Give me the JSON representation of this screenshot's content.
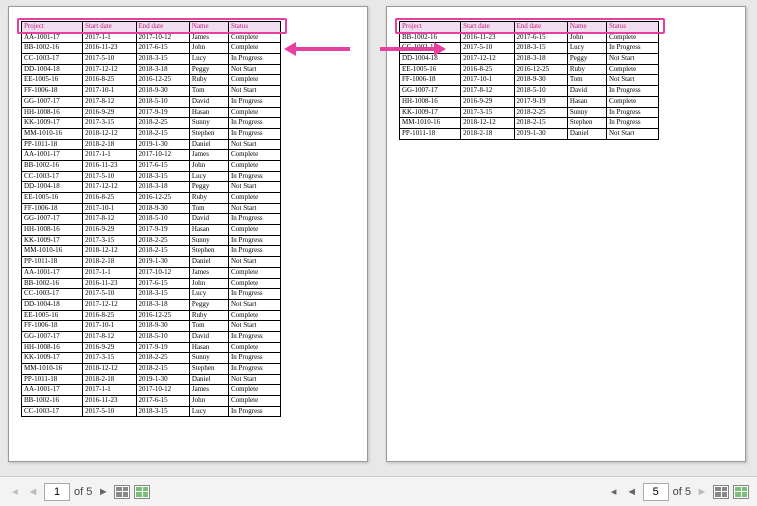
{
  "columns": [
    "Project",
    "Start date",
    "End date",
    "Name",
    "Status"
  ],
  "page1": {
    "rows": [
      [
        "AA-1001-17",
        "2017-1-1",
        "2017-10-12",
        "James",
        "Complete"
      ],
      [
        "BB-1002-16",
        "2016-11-23",
        "2017-6-15",
        "John",
        "Complete"
      ],
      [
        "CC-1003-17",
        "2017-5-10",
        "2018-3-15",
        "Lucy",
        "In Progress"
      ],
      [
        "DD-1004-18",
        "2017-12-12",
        "2018-3-18",
        "Peggy",
        "Not Start"
      ],
      [
        "EE-1005-16",
        "2016-8-25",
        "2016-12-25",
        "Ruby",
        "Complete"
      ],
      [
        "FF-1006-18",
        "2017-10-1",
        "2018-9-30",
        "Tom",
        "Not Start"
      ],
      [
        "GG-1007-17",
        "2017-8-12",
        "2018-5-10",
        "David",
        "In Progress"
      ],
      [
        "HH-1008-16",
        "2016-9-29",
        "2017-9-19",
        "Hasan",
        "Complete"
      ],
      [
        "KK-1009-17",
        "2017-3-15",
        "2018-2-25",
        "Sunny",
        "In Progress"
      ],
      [
        "MM-1010-16",
        "2018-12-12",
        "2018-2-15",
        "Stephen",
        "In Progress"
      ],
      [
        "PP-1011-18",
        "2018-2-18",
        "2019-1-30",
        "Daniel",
        "Not Start"
      ],
      [
        "AA-1001-17",
        "2017-1-1",
        "2017-10-12",
        "James",
        "Complete"
      ],
      [
        "BB-1002-16",
        "2016-11-23",
        "2017-6-15",
        "John",
        "Complete"
      ],
      [
        "CC-1003-17",
        "2017-5-10",
        "2018-3-15",
        "Lucy",
        "In Progress"
      ],
      [
        "DD-1004-18",
        "2017-12-12",
        "2018-3-18",
        "Peggy",
        "Not Start"
      ],
      [
        "EE-1005-16",
        "2016-8-25",
        "2016-12-25",
        "Ruby",
        "Complete"
      ],
      [
        "FF-1006-18",
        "2017-10-1",
        "2018-9-30",
        "Tom",
        "Not Start"
      ],
      [
        "GG-1007-17",
        "2017-8-12",
        "2018-5-10",
        "David",
        "In Progress"
      ],
      [
        "HH-1008-16",
        "2016-9-29",
        "2017-9-19",
        "Hasan",
        "Complete"
      ],
      [
        "KK-1009-17",
        "2017-3-15",
        "2018-2-25",
        "Sunny",
        "In Progress"
      ],
      [
        "MM-1010-16",
        "2018-12-12",
        "2018-2-15",
        "Stephen",
        "In Progress"
      ],
      [
        "PP-1011-18",
        "2018-2-18",
        "2019-1-30",
        "Daniel",
        "Not Start"
      ],
      [
        "AA-1001-17",
        "2017-1-1",
        "2017-10-12",
        "James",
        "Complete"
      ],
      [
        "BB-1002-16",
        "2016-11-23",
        "2017-6-15",
        "John",
        "Complete"
      ],
      [
        "CC-1003-17",
        "2017-5-10",
        "2018-3-15",
        "Lucy",
        "In Progress"
      ],
      [
        "DD-1004-18",
        "2017-12-12",
        "2018-3-18",
        "Peggy",
        "Not Start"
      ],
      [
        "EE-1005-16",
        "2016-8-25",
        "2016-12-25",
        "Ruby",
        "Complete"
      ],
      [
        "FF-1006-18",
        "2017-10-1",
        "2018-9-30",
        "Tom",
        "Not Start"
      ],
      [
        "GG-1007-17",
        "2017-8-12",
        "2018-5-10",
        "David",
        "In Progress"
      ],
      [
        "HH-1008-16",
        "2016-9-29",
        "2017-9-19",
        "Hasan",
        "Complete"
      ],
      [
        "KK-1009-17",
        "2017-3-15",
        "2018-2-25",
        "Sunny",
        "In Progress"
      ],
      [
        "MM-1010-16",
        "2018-12-12",
        "2018-2-15",
        "Stephen",
        "In Progress"
      ],
      [
        "PP-1011-18",
        "2018-2-18",
        "2019-1-30",
        "Daniel",
        "Not Start"
      ],
      [
        "AA-1001-17",
        "2017-1-1",
        "2017-10-12",
        "James",
        "Complete"
      ],
      [
        "BB-1002-16",
        "2016-11-23",
        "2017-6-15",
        "John",
        "Complete"
      ],
      [
        "CC-1003-17",
        "2017-5-10",
        "2018-3-15",
        "Lucy",
        "In Progress"
      ]
    ],
    "current": "1",
    "total": "of 5"
  },
  "page5": {
    "rows": [
      [
        "BB-1002-16",
        "2016-11-23",
        "2017-6-15",
        "John",
        "Complete"
      ],
      [
        "CC-1003-17",
        "2017-5-10",
        "2018-3-15",
        "Lucy",
        "In Progress"
      ],
      [
        "DD-1004-18",
        "2017-12-12",
        "2018-3-18",
        "Peggy",
        "Not Start"
      ],
      [
        "EE-1005-16",
        "2016-8-25",
        "2016-12-25",
        "Ruby",
        "Complete"
      ],
      [
        "FF-1006-18",
        "2017-10-1",
        "2018-9-30",
        "Tom",
        "Not Start"
      ],
      [
        "GG-1007-17",
        "2017-8-12",
        "2018-5-10",
        "David",
        "In Progress"
      ],
      [
        "HH-1008-16",
        "2016-9-29",
        "2017-9-19",
        "Hasan",
        "Complete"
      ],
      [
        "KK-1009-17",
        "2017-3-15",
        "2018-2-25",
        "Sunny",
        "In Progress"
      ],
      [
        "MM-1010-16",
        "2018-12-12",
        "2018-2-15",
        "Stephen",
        "In Progress"
      ],
      [
        "PP-1011-18",
        "2018-2-18",
        "2019-1-30",
        "Daniel",
        "Not Start"
      ]
    ],
    "current": "5",
    "total": "of 5"
  }
}
